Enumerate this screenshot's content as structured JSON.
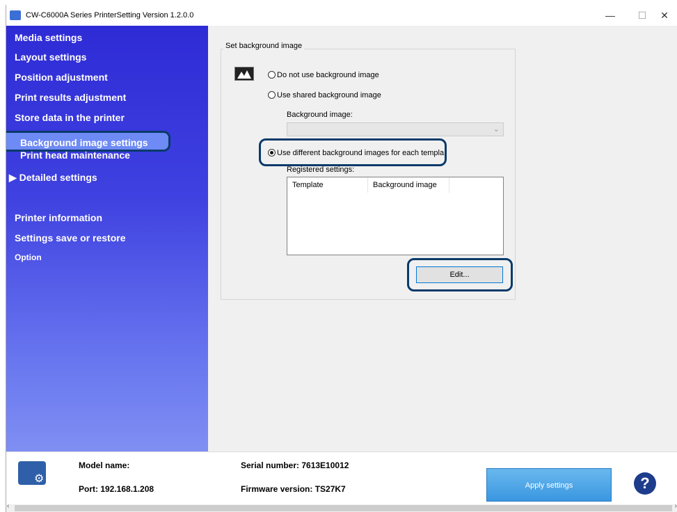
{
  "window": {
    "title": "CW-C6000A Series PrinterSetting Version 1.2.0.0",
    "minimize": "—",
    "maximize": "☐",
    "close": "✕"
  },
  "sidebar": {
    "items": [
      {
        "label": "Media settings"
      },
      {
        "label": "Layout settings"
      },
      {
        "label": "Position adjustment"
      },
      {
        "label": "Print results adjustment"
      },
      {
        "label": "Store data in the printer"
      },
      {
        "label": "Background image settings",
        "selected": true
      },
      {
        "label": "Print head maintenance"
      },
      {
        "label": "▶ Detailed settings"
      },
      {
        "label": "Printer information"
      },
      {
        "label": "Settings save or restore"
      },
      {
        "label": "Option"
      }
    ]
  },
  "main": {
    "group_title": "Set background image",
    "radio_none": "Do not use background image",
    "radio_shared": "Use shared background image",
    "background_image_label": "Background image:",
    "radio_different": "Use different background images for each templa",
    "selected_option": "radio_different",
    "registered_label": "Registered settings:",
    "columns": [
      "Template",
      "Background image"
    ],
    "rows": [],
    "edit_button": "Edit..."
  },
  "footer": {
    "model_label": "Model name:",
    "port": "Port: 192.168.1.208",
    "serial": "Serial number: 7613E10012",
    "firmware": "Firmware version: TS27K7",
    "apply_button": "Apply settings",
    "help": "?"
  },
  "icons": [
    "app-icon",
    "image-icon",
    "chevron-down-icon",
    "printer-settings-icon",
    "help-icon"
  ],
  "colors": {
    "sidebar_top": "#2e2bd6",
    "sidebar_bottom": "#7f8ff2",
    "highlight_border": "#0a3a6a",
    "apply_button": "#3a97e0"
  }
}
